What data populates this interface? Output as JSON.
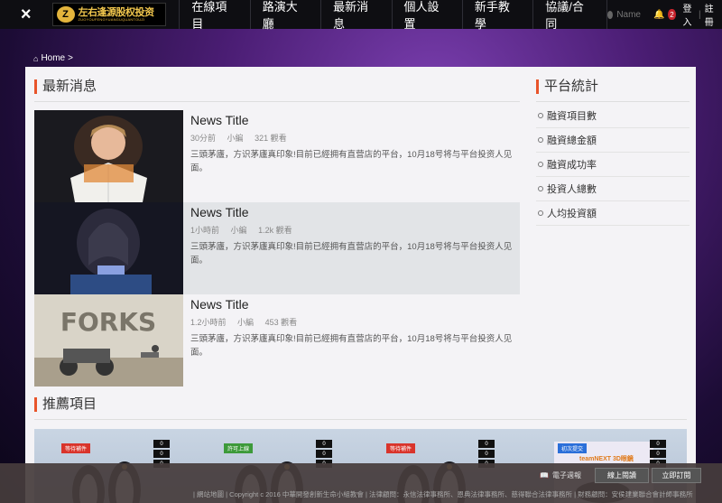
{
  "nav": {
    "close_icon": "×",
    "logo": {
      "cn": "左右逢源股权投资",
      "en": "ZUOYOUFENGYUANGUQUANTOUZI",
      "mark": "Z"
    },
    "items": [
      "在線項目",
      "路演大廳",
      "最新消息",
      "個人設置",
      "新手教學",
      "協議/合同"
    ],
    "user_name": "Name",
    "notification_count": "2",
    "login": "登入",
    "separator": "|",
    "register": "註冊"
  },
  "breadcrumb": {
    "home": "Home",
    "sep": ">"
  },
  "news": {
    "title": "最新消息",
    "items": [
      {
        "title": "News Title",
        "time": "30分前",
        "author": "小編",
        "views": "321 觀看",
        "desc": "三頭茅廬，方识茅廬真印象!目前已經拥有直营店的平台，10月18号将与平台投资人见面。"
      },
      {
        "title": "News Title",
        "time": "1小時前",
        "author": "小編",
        "views": "1.2k 觀看",
        "desc": "三頭茅廬，方识茅廬真印象!目前已經拥有直营店的平台，10月18号将与平台投资人见面。"
      },
      {
        "title": "News Title",
        "time": "1.2小時前",
        "author": "小編",
        "views": "453 觀看",
        "desc": "三頭茅廬，方识茅廬真印象!目前已經拥有直营店的平台，10月18号将与平台投资人见面。"
      }
    ],
    "thumb3_text": "FORKS"
  },
  "stats": {
    "title": "平台統計",
    "items": [
      "融資項目數",
      "融資總金額",
      "融資成功率",
      "投資人總數",
      "人均投資額"
    ]
  },
  "recommend": {
    "title": "推薦項目",
    "cards": [
      {
        "tag": "等待補件",
        "counts": [
          "0",
          "0",
          "0"
        ],
        "tag_color": "#d9342b"
      },
      {
        "tag": "許可上線",
        "counts": [
          "0",
          "0",
          "0"
        ],
        "tag_color": "#3d9a3a"
      },
      {
        "tag": "等待補件",
        "counts": [
          "0",
          "0",
          "0"
        ],
        "tag_color": "#d9342b"
      },
      {
        "tag": "初次提交",
        "counts": [
          "0",
          "0",
          "0"
        ],
        "tag_color": "#2b6fd9",
        "extra": "teamNEXT 3D眼鏡"
      }
    ]
  },
  "footer": {
    "ebook": "電子週報",
    "online": "線上閱讀",
    "subscribe": "立即訂閱",
    "text": "| 網站地圖 | Copyright c 2016 中華開發創新生命小組教會 | 法律顧問：永信法律事務所、恩典法律事務所、慈得聯合法律事務所 | 財務顧問：安侯建業聯合會計師事務所"
  },
  "colors": {
    "accent": "#e8542a",
    "navbar": "#0e0e12",
    "badge": "#c8232c"
  }
}
